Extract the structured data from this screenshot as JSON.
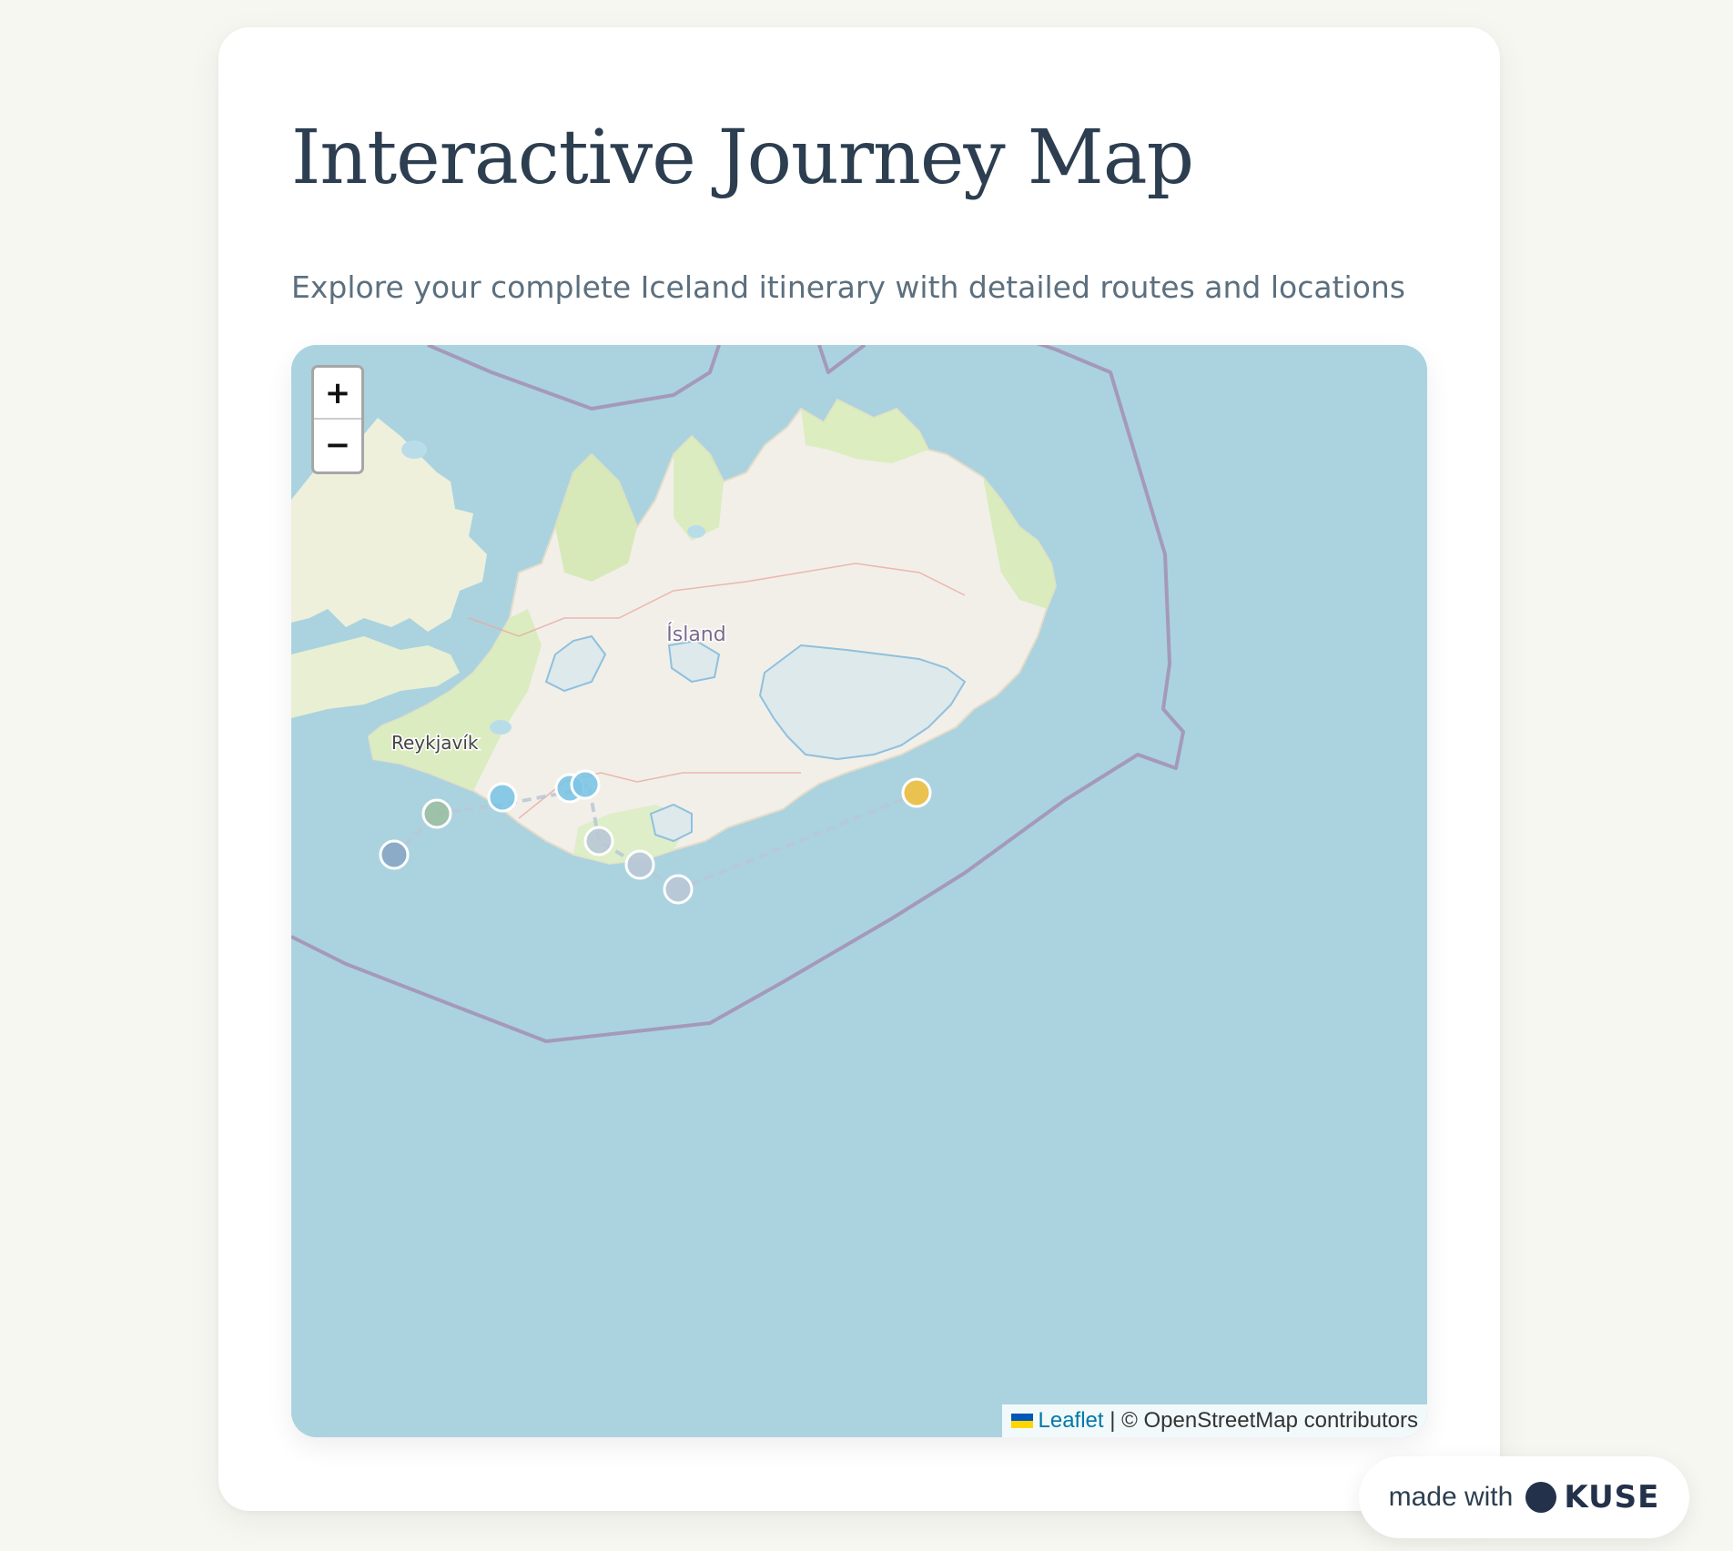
{
  "page": {
    "title": "Interactive Journey Map",
    "subtitle": "Explore your complete Iceland itinerary with detailed routes and locations"
  },
  "map": {
    "labels": {
      "country": "Ísland",
      "capital": "Reykjavík"
    },
    "zoom_in_label": "+",
    "zoom_out_label": "−",
    "attribution": {
      "link_text": "Leaflet",
      "separator": " | ",
      "credit_text": "© OpenStreetMap contributors"
    },
    "colors": {
      "sea": "#aad3df",
      "land": "#f2efe9",
      "vegetation": "#d6ecb5",
      "glacier": "#ddecec",
      "border": "#9d8fb0"
    },
    "markers": [
      {
        "color": "#88a6c4"
      },
      {
        "color": "#9cbfa3"
      },
      {
        "color": "#7cc4e4"
      },
      {
        "color": "#7cc4e4"
      },
      {
        "color": "#7cc4e4"
      },
      {
        "color": "#b9c7d6"
      },
      {
        "color": "#b9c7d6"
      },
      {
        "color": "#b9c7d6"
      },
      {
        "color": "#f0c040"
      }
    ]
  },
  "badge": {
    "made_with": "made with",
    "brand": "KUSE"
  }
}
